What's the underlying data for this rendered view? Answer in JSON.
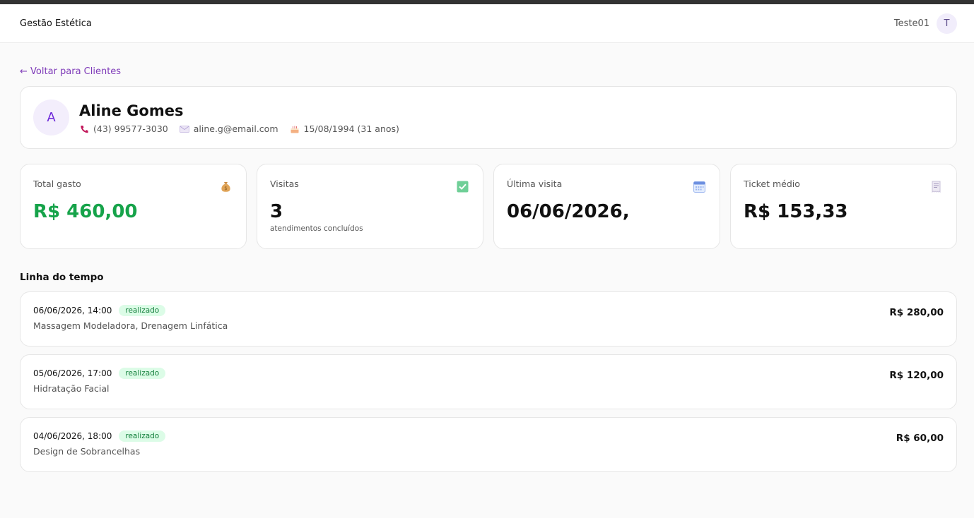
{
  "header": {
    "brand": "Gestão Estética",
    "user_name": "Teste01",
    "user_initial": "T"
  },
  "back_link": "← Voltar para Clientes",
  "client": {
    "initial": "A",
    "name": "Aline Gomes",
    "phone": "(43) 99577-3030",
    "email": "aline.g@email.com",
    "birthdate": "15/08/1994 (31 anos)"
  },
  "stats": [
    {
      "label": "Total gasto",
      "value": "R$ 460,00",
      "sub": "",
      "icon": "money-bag-icon"
    },
    {
      "label": "Visitas",
      "value": "3",
      "sub": "atendimentos concluídos",
      "icon": "check-box-icon"
    },
    {
      "label": "Última visita",
      "value": "06/06/2026,",
      "sub": "",
      "icon": "calendar-icon"
    },
    {
      "label": "Ticket médio",
      "value": "R$ 153,33",
      "sub": "",
      "icon": "receipt-icon"
    }
  ],
  "timeline_title": "Linha do tempo",
  "timeline": [
    {
      "datetime": "06/06/2026, 14:00",
      "status": "realizado",
      "services": "Massagem Modeladora, Drenagem Linfática",
      "amount": "R$ 280,00"
    },
    {
      "datetime": "05/06/2026, 17:00",
      "status": "realizado",
      "services": "Hidratação Facial",
      "amount": "R$ 120,00"
    },
    {
      "datetime": "04/06/2026, 18:00",
      "status": "realizado",
      "services": "Design de Sobrancelhas",
      "amount": "R$ 60,00"
    }
  ],
  "colors": {
    "accent": "#7e3ab8",
    "green": "#16a34a",
    "badge_bg": "#dcfce7"
  }
}
